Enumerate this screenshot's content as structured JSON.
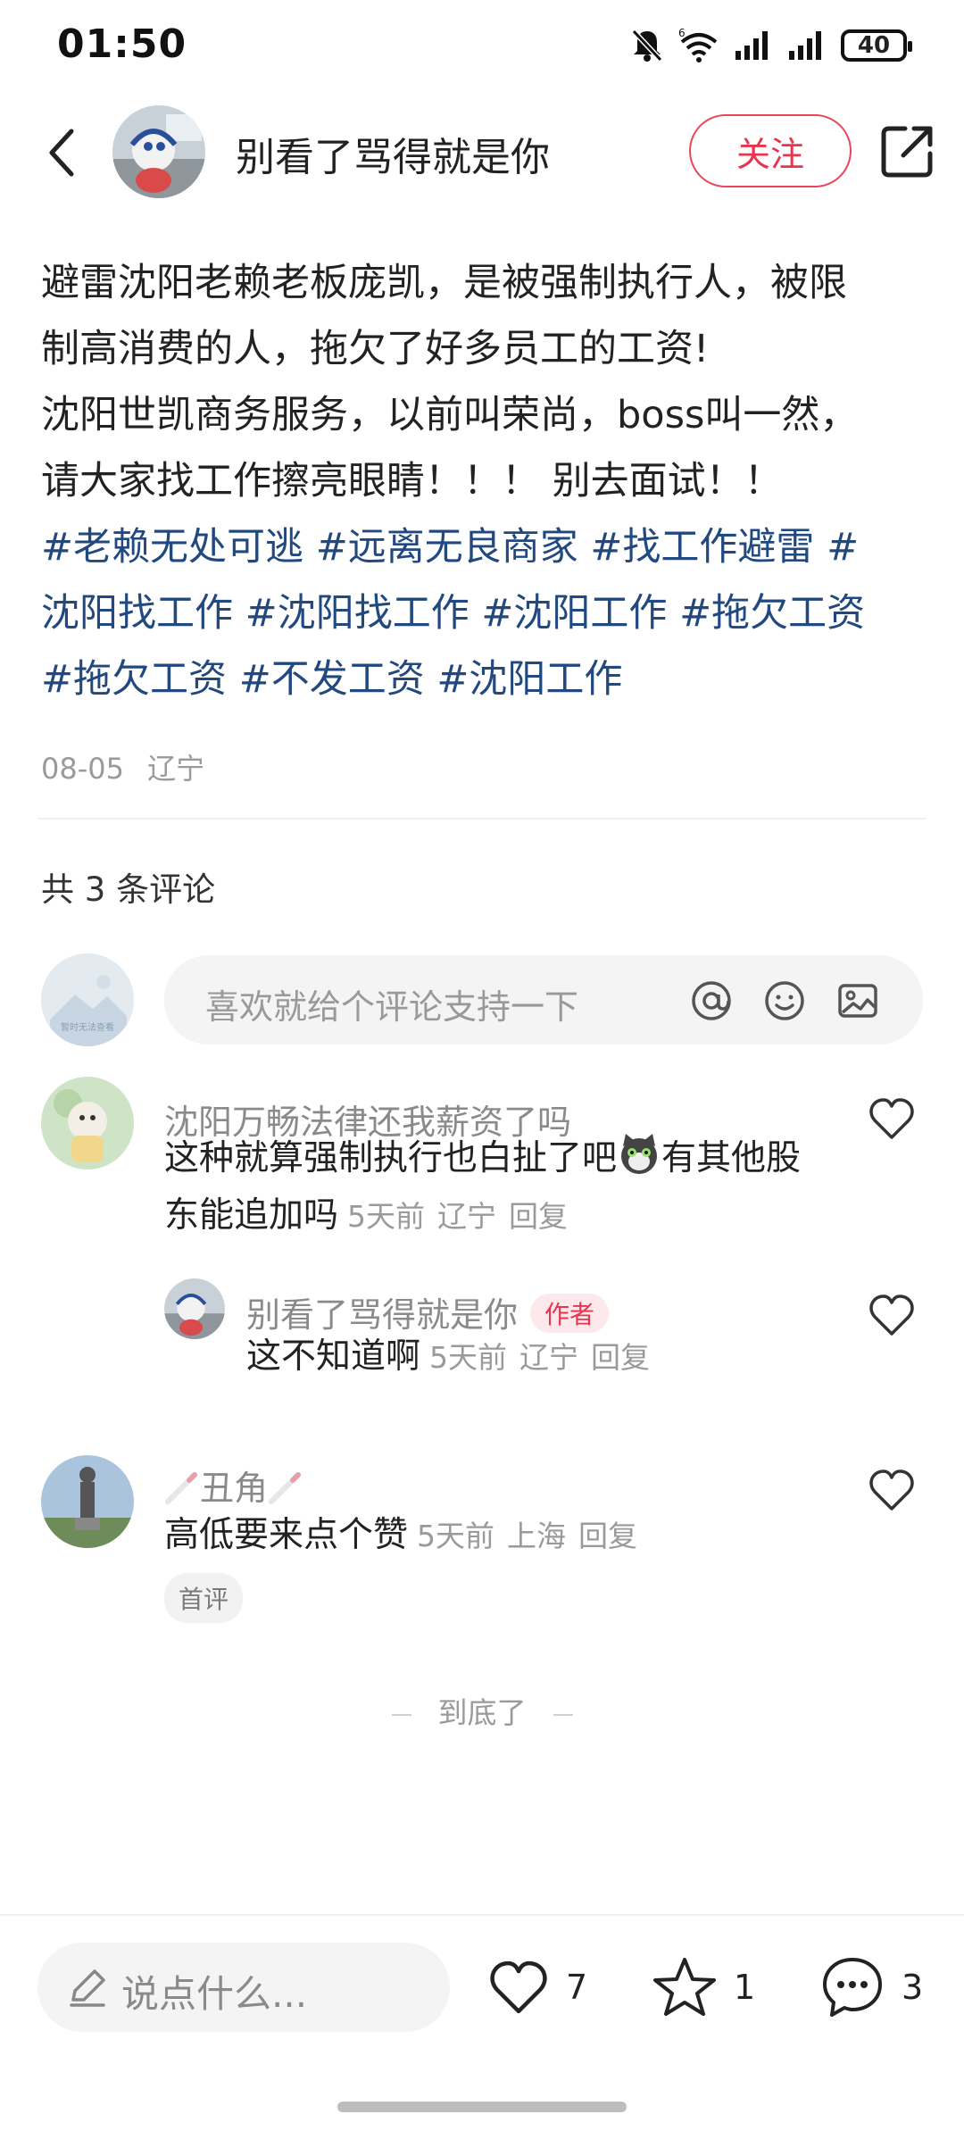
{
  "status_bar": {
    "time": "01:50",
    "battery": "40",
    "icons": [
      "bell-muted-icon",
      "wifi-icon",
      "signal-icon",
      "signal-icon",
      "battery-icon"
    ]
  },
  "header": {
    "author_name": "别看了骂得就是你",
    "follow_label": "关注"
  },
  "post": {
    "lines": [
      "避雷沈阳老赖老板庞凯，是被强制执行人，被限",
      "制高消费的人，拖欠了好多员工的工资!",
      "沈阳世凯商务服务，以前叫荣尚，boss叫一然，",
      "请大家找工作擦亮眼睛！！！ 别去面试！！"
    ],
    "tag_lines": [
      "#老赖无处可逃 #远离无良商家 #找工作避雷 #",
      "沈阳找工作 #沈阳找工作 #沈阳工作 #拖欠工资",
      "#拖欠工资 #不发工资 #沈阳工作"
    ],
    "date": "08-05",
    "location": "辽宁"
  },
  "comments_section": {
    "count_label": "共 3 条评论",
    "input_placeholder": "喜欢就给个评论支持一下",
    "avatar_caption": "暂时无法查看",
    "comments": [
      {
        "name": "沈阳万畅法律还我薪资了吗",
        "text_a": "这种就算强制执行也白扯了吧",
        "text_b": "有其他股",
        "text_c": "东能追加吗",
        "time": "5天前",
        "location": "辽宁",
        "reply": "回复"
      },
      {
        "name": "别看了骂得就是你",
        "badge": "作者",
        "text": "这不知道啊",
        "time": "5天前",
        "location": "辽宁",
        "reply": "回复"
      },
      {
        "name": "丑角",
        "text": "高低要来点个赞",
        "time": "5天前",
        "location": "上海",
        "reply": "回复",
        "badge": "首评"
      }
    ],
    "end_label": "到底了"
  },
  "bottom_bar": {
    "say_placeholder": "说点什么...",
    "like_count": "7",
    "star_count": "1",
    "comment_count": "3"
  }
}
